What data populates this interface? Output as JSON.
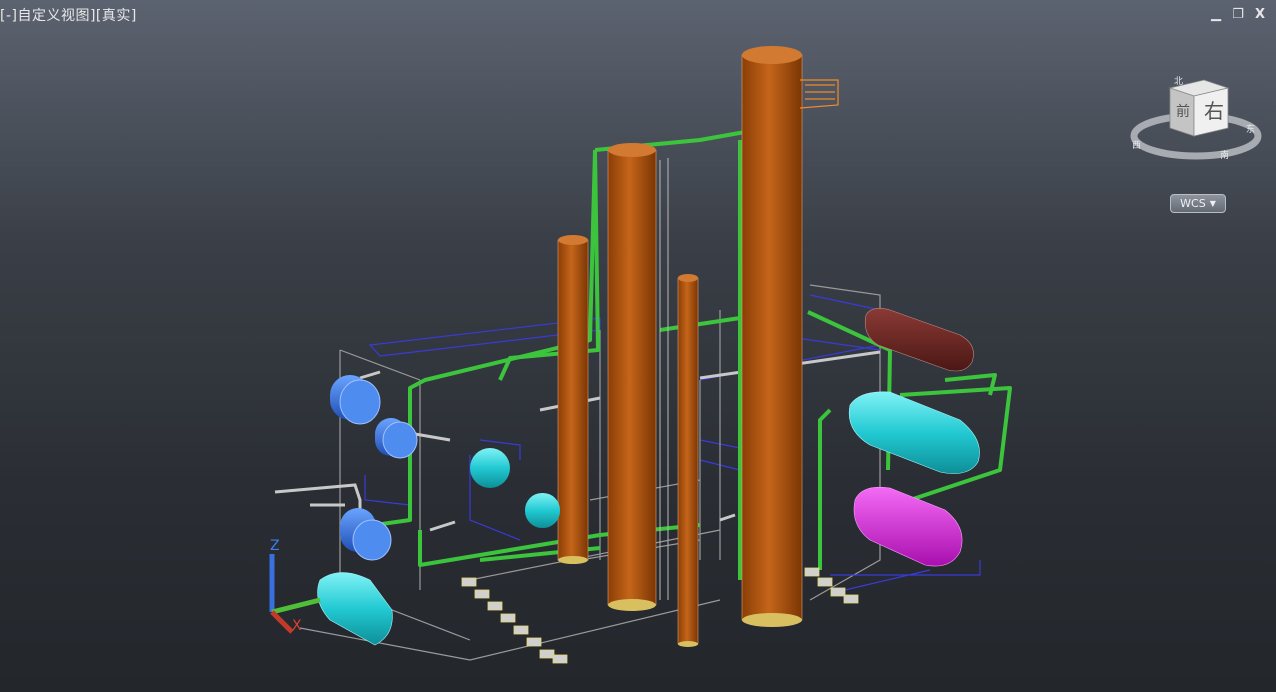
{
  "viewport": {
    "label": "[-]自定义视图][真实]"
  },
  "window_controls": {
    "minimize": "▁",
    "restore": "❐",
    "close": "X"
  },
  "viewcube": {
    "front_face": "前",
    "right_face": "右",
    "compass_north": "北",
    "compass_south": "南",
    "compass_east": "东",
    "compass_west": "西"
  },
  "wcs": {
    "label": "WCS",
    "caret": "▼"
  },
  "ucs_icon": {
    "z_label": "Z",
    "x_label": "X"
  },
  "colors": {
    "column": "#b85a12",
    "pipe_green": "#3cc43c",
    "vessel_blue": "#2f6fd6",
    "vessel_cyan": "#26d0d8",
    "vessel_magenta": "#d21cd6",
    "vessel_maroon": "#6e2a26",
    "frame_blue": "#3a3ad8"
  }
}
